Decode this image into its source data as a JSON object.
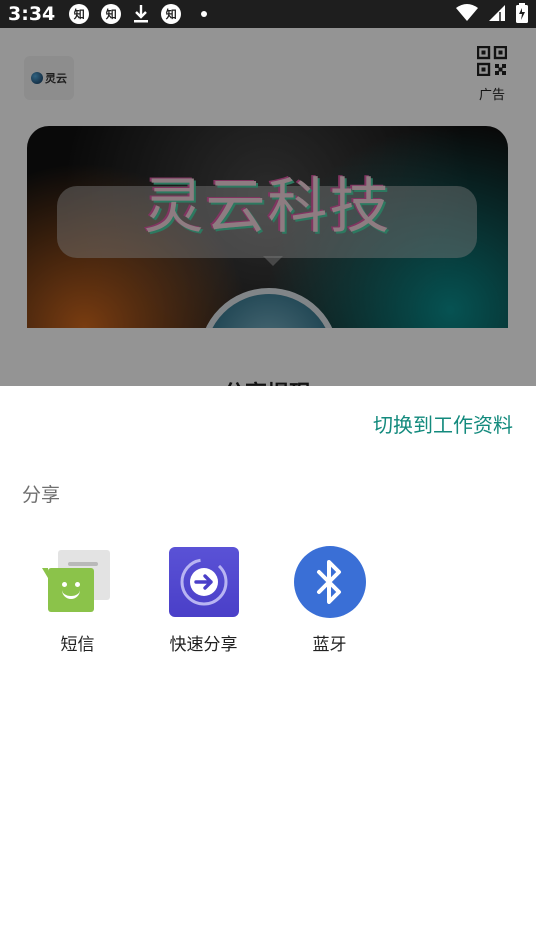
{
  "status_bar": {
    "time": "3:34",
    "notification_icons": [
      "知",
      "知",
      "知"
    ]
  },
  "background_app": {
    "logo_text": "灵云",
    "qr_label": "广告",
    "banner_title": "灵云科技",
    "card_title": "分享提现"
  },
  "share_sheet": {
    "switch_profile_label": "切换到工作资料",
    "title": "分享",
    "targets": [
      {
        "label": "短信",
        "icon": "sms-icon"
      },
      {
        "label": "快速分享",
        "icon": "quick-share-icon"
      },
      {
        "label": "蓝牙",
        "icon": "bluetooth-icon"
      }
    ]
  },
  "colors": {
    "accent": "#138a7d",
    "sms_green": "#8bc34a",
    "quick_share_purple": "#4a3fc8",
    "bluetooth_blue": "#3a6fd6"
  }
}
